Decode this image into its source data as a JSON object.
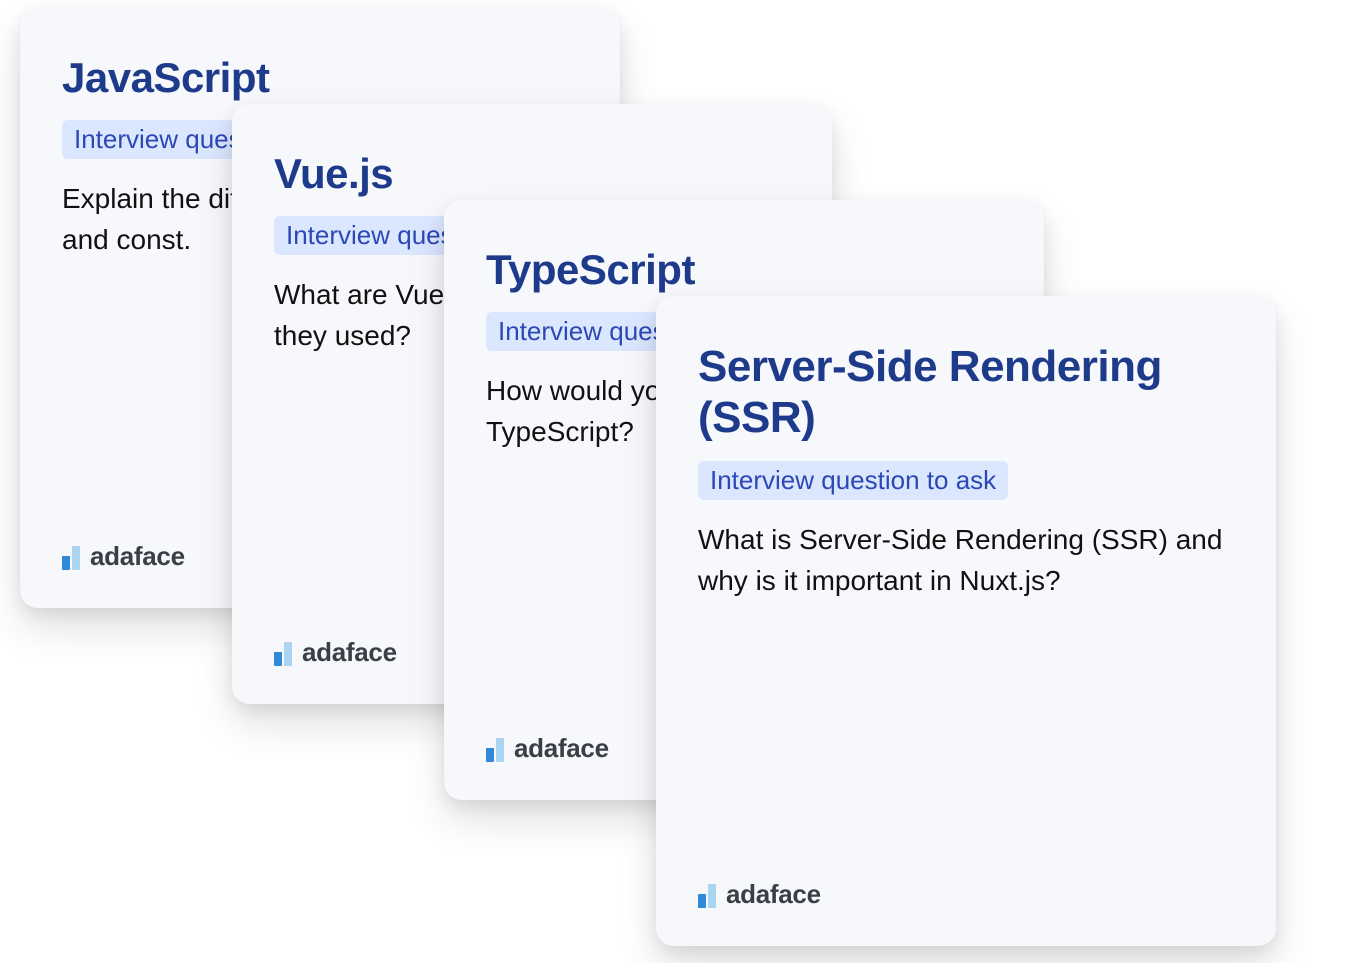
{
  "badge_label": "Interview question to ask",
  "brand": "adaface",
  "cards": [
    {
      "title": "JavaScript",
      "question": "Explain the difference between var, let, and const."
    },
    {
      "title": "Vue.js",
      "question": "What are Vue directives and how are they used?"
    },
    {
      "title": "TypeScript",
      "question": "How would you define types in TypeScript?"
    },
    {
      "title": "Server-Side Rendering (SSR)",
      "question": "What is Server-Side Rendering (SSR) and why is it important in Nuxt.js?"
    }
  ]
}
